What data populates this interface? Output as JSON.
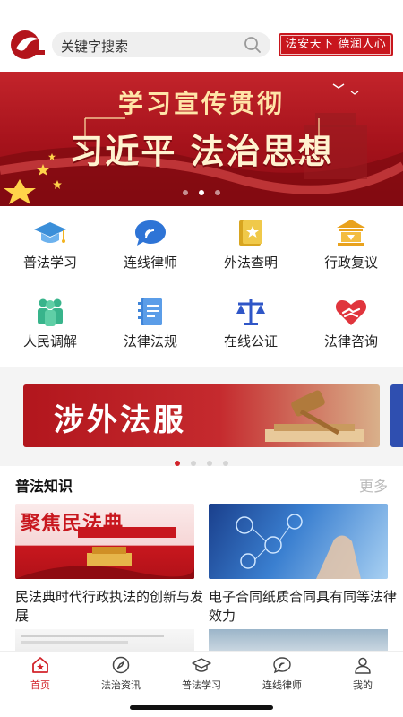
{
  "search": {
    "placeholder": "关键字搜索"
  },
  "header": {
    "slogan": "法安天下 德润人心"
  },
  "banner": {
    "line1": "学习宣传贯彻",
    "line2": "习近平 法治思想"
  },
  "grid": {
    "row1": [
      {
        "label": "普法学习",
        "icon": "graduation-cap-icon"
      },
      {
        "label": "连线律师",
        "icon": "chat-bubble-icon"
      },
      {
        "label": "外法查明",
        "icon": "book-star-icon"
      },
      {
        "label": "行政复议",
        "icon": "courthouse-icon"
      }
    ],
    "row2": [
      {
        "label": "人民调解",
        "icon": "people-icon"
      },
      {
        "label": "法律法规",
        "icon": "notebook-icon"
      },
      {
        "label": "在线公证",
        "icon": "scales-icon"
      },
      {
        "label": "法律咨询",
        "icon": "heart-handshake-icon"
      }
    ]
  },
  "ad": {
    "text": "涉外法服"
  },
  "section": {
    "title": "普法知识",
    "more": "更多"
  },
  "cards": [
    {
      "title": "民法典时代行政执法的创新与发展",
      "image_text": "聚焦民法典"
    },
    {
      "title": "电子合同纸质合同具有同等法律效力"
    }
  ],
  "tabbar": {
    "items": [
      {
        "label": "首页",
        "icon": "home-icon",
        "active": true
      },
      {
        "label": "法治资讯",
        "icon": "compass-icon"
      },
      {
        "label": "普法学习",
        "icon": "graduation-cap-icon"
      },
      {
        "label": "连线律师",
        "icon": "chat-bubble-icon"
      },
      {
        "label": "我的",
        "icon": "user-icon"
      }
    ]
  },
  "colors": {
    "brand_red": "#d2232a",
    "banner_red": "#a5121b",
    "gold": "#ffe5a8"
  }
}
